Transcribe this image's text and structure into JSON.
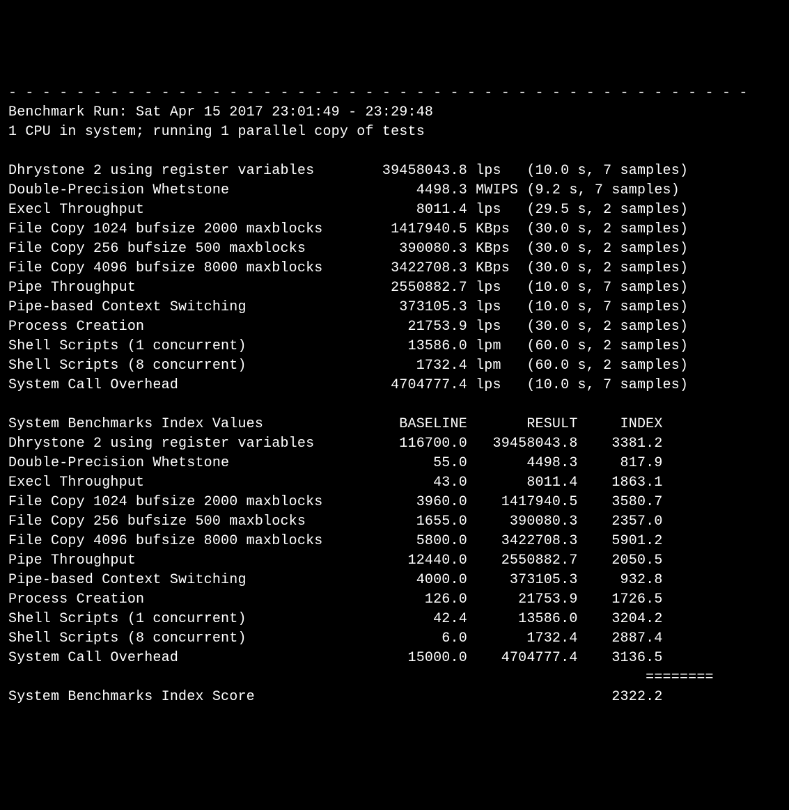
{
  "separator": "- - - - - - - - - - - - - - - - - - - - - - - - - - - - - - - - - - - - - - - - - - - -",
  "header": {
    "run_line": "Benchmark Run: Sat Apr 15 2017 23:01:49 - 23:29:48",
    "cpu_line": "1 CPU in system; running 1 parallel copy of tests"
  },
  "tests": [
    {
      "name": "Dhrystone 2 using register variables",
      "value": "39458043.8",
      "unit": "lps",
      "timing": "(10.0 s, 7 samples)"
    },
    {
      "name": "Double-Precision Whetstone",
      "value": "4498.3",
      "unit": "MWIPS",
      "timing": "(9.2 s, 7 samples)"
    },
    {
      "name": "Execl Throughput",
      "value": "8011.4",
      "unit": "lps",
      "timing": "(29.5 s, 2 samples)"
    },
    {
      "name": "File Copy 1024 bufsize 2000 maxblocks",
      "value": "1417940.5",
      "unit": "KBps",
      "timing": "(30.0 s, 2 samples)"
    },
    {
      "name": "File Copy 256 bufsize 500 maxblocks",
      "value": "390080.3",
      "unit": "KBps",
      "timing": "(30.0 s, 2 samples)"
    },
    {
      "name": "File Copy 4096 bufsize 8000 maxblocks",
      "value": "3422708.3",
      "unit": "KBps",
      "timing": "(30.0 s, 2 samples)"
    },
    {
      "name": "Pipe Throughput",
      "value": "2550882.7",
      "unit": "lps",
      "timing": "(10.0 s, 7 samples)"
    },
    {
      "name": "Pipe-based Context Switching",
      "value": "373105.3",
      "unit": "lps",
      "timing": "(10.0 s, 7 samples)"
    },
    {
      "name": "Process Creation",
      "value": "21753.9",
      "unit": "lps",
      "timing": "(30.0 s, 2 samples)"
    },
    {
      "name": "Shell Scripts (1 concurrent)",
      "value": "13586.0",
      "unit": "lpm",
      "timing": "(60.0 s, 2 samples)"
    },
    {
      "name": "Shell Scripts (8 concurrent)",
      "value": "1732.4",
      "unit": "lpm",
      "timing": "(60.0 s, 2 samples)"
    },
    {
      "name": "System Call Overhead",
      "value": "4704777.4",
      "unit": "lps",
      "timing": "(10.0 s, 7 samples)"
    }
  ],
  "index_header": {
    "title": "System Benchmarks Index Values",
    "col1": "BASELINE",
    "col2": "RESULT",
    "col3": "INDEX"
  },
  "index_rows": [
    {
      "name": "Dhrystone 2 using register variables",
      "baseline": "116700.0",
      "result": "39458043.8",
      "index": "3381.2"
    },
    {
      "name": "Double-Precision Whetstone",
      "baseline": "55.0",
      "result": "4498.3",
      "index": "817.9"
    },
    {
      "name": "Execl Throughput",
      "baseline": "43.0",
      "result": "8011.4",
      "index": "1863.1"
    },
    {
      "name": "File Copy 1024 bufsize 2000 maxblocks",
      "baseline": "3960.0",
      "result": "1417940.5",
      "index": "3580.7"
    },
    {
      "name": "File Copy 256 bufsize 500 maxblocks",
      "baseline": "1655.0",
      "result": "390080.3",
      "index": "2357.0"
    },
    {
      "name": "File Copy 4096 bufsize 8000 maxblocks",
      "baseline": "5800.0",
      "result": "3422708.3",
      "index": "5901.2"
    },
    {
      "name": "Pipe Throughput",
      "baseline": "12440.0",
      "result": "2550882.7",
      "index": "2050.5"
    },
    {
      "name": "Pipe-based Context Switching",
      "baseline": "4000.0",
      "result": "373105.3",
      "index": "932.8"
    },
    {
      "name": "Process Creation",
      "baseline": "126.0",
      "result": "21753.9",
      "index": "1726.5"
    },
    {
      "name": "Shell Scripts (1 concurrent)",
      "baseline": "42.4",
      "result": "13586.0",
      "index": "3204.2"
    },
    {
      "name": "Shell Scripts (8 concurrent)",
      "baseline": "6.0",
      "result": "1732.4",
      "index": "2887.4"
    },
    {
      "name": "System Call Overhead",
      "baseline": "15000.0",
      "result": "4704777.4",
      "index": "3136.5"
    }
  ],
  "score_separator": "                                                                           ========",
  "final_score": {
    "label": "System Benchmarks Index Score",
    "value": "2322.2"
  }
}
